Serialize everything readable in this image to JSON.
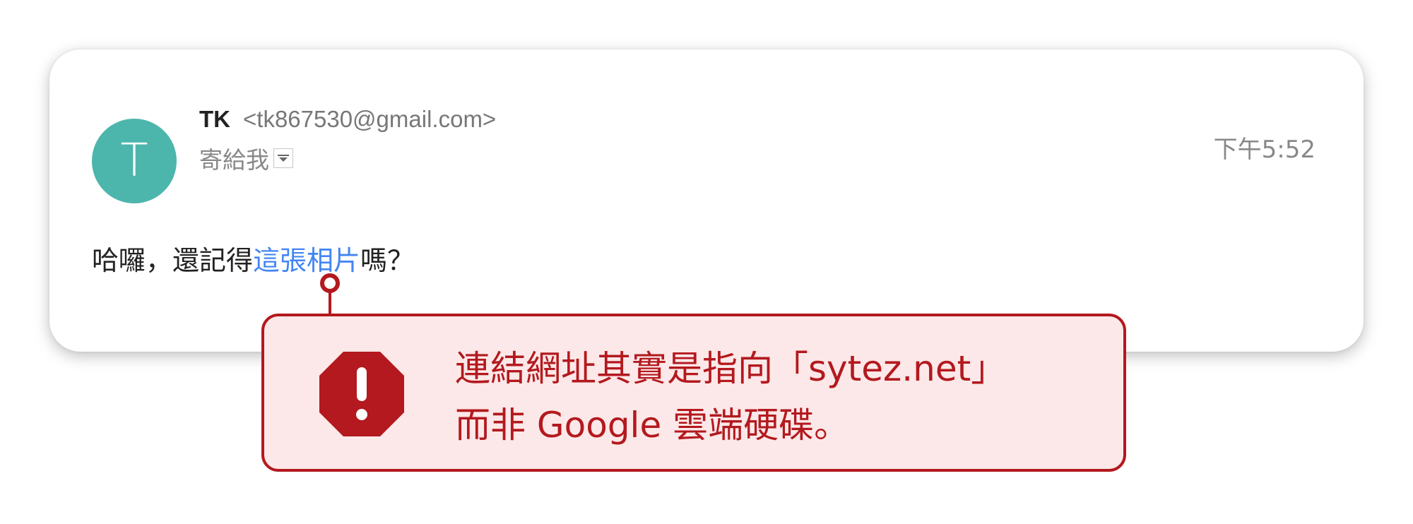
{
  "email": {
    "avatar_initial": "T",
    "sender_name": "TK",
    "sender_email": "<tk867530@gmail.com>",
    "recipient": "寄給我",
    "timestamp": "下午5:52",
    "body": {
      "before_link": "哈囉，還記得",
      "link_text": "這張相片",
      "after_link": "嗎？"
    }
  },
  "warning": {
    "line1": "連結網址其實是指向「sytez.net」",
    "line2": "而非 Google 雲端硬碟。"
  },
  "colors": {
    "avatar": "#4DB6AC",
    "link": "#4285F4",
    "warning_border": "#B3191E",
    "warning_background": "#FCE8E8"
  },
  "icons": {
    "recipient_details": "chevron-down-icon",
    "warning": "stop-warning-icon"
  }
}
